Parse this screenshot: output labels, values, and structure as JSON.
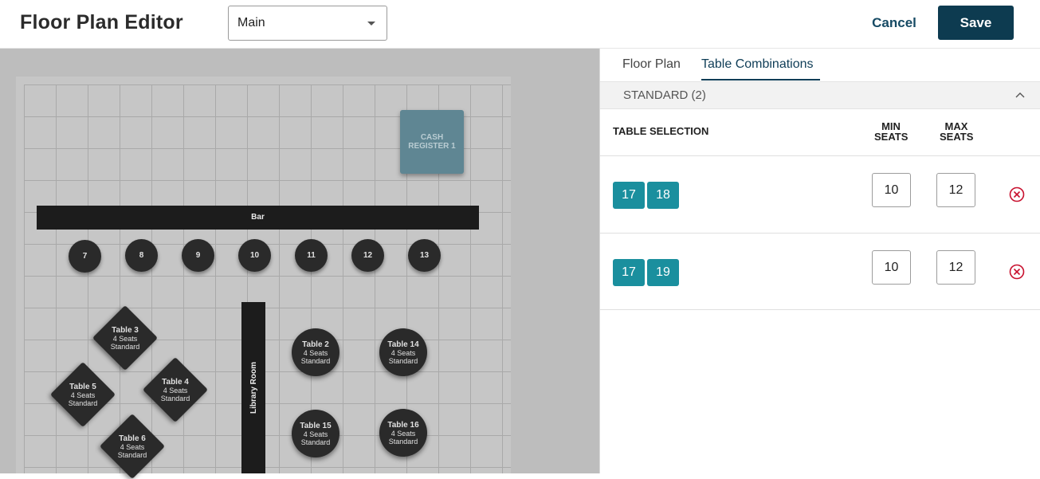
{
  "header": {
    "title": "Floor Plan Editor",
    "floor_select": {
      "value": "Main"
    },
    "cancel_label": "Cancel",
    "save_label": "Save"
  },
  "colors": {
    "primary": "#0d3b50",
    "chip": "#1a8f9e",
    "remove": "#c8102e"
  },
  "floor_plan": {
    "cash_register": "CASH REGISTER 1",
    "bar": "Bar",
    "library_room": "Library Room",
    "stools": [
      "7",
      "8",
      "9",
      "10",
      "11",
      "12",
      "13"
    ],
    "tables": [
      {
        "name": "Table 3",
        "seats": "4 Seats",
        "type": "Standard",
        "shape": "diamond"
      },
      {
        "name": "Table 4",
        "seats": "4 Seats",
        "type": "Standard",
        "shape": "diamond"
      },
      {
        "name": "Table 5",
        "seats": "4 Seats",
        "type": "Standard",
        "shape": "diamond"
      },
      {
        "name": "Table 6",
        "seats": "4 Seats",
        "type": "Standard",
        "shape": "diamond"
      },
      {
        "name": "Table 2",
        "seats": "4 Seats",
        "type": "Standard",
        "shape": "round"
      },
      {
        "name": "Table 14",
        "seats": "4 Seats",
        "type": "Standard",
        "shape": "round"
      },
      {
        "name": "Table 15",
        "seats": "4 Seats",
        "type": "Standard",
        "shape": "round"
      },
      {
        "name": "Table 16",
        "seats": "4 Seats",
        "type": "Standard",
        "shape": "round"
      }
    ]
  },
  "panel": {
    "tabs": [
      {
        "label": "Floor Plan",
        "active": false
      },
      {
        "label": "Table Combinations",
        "active": true
      }
    ],
    "section": {
      "label": "STANDARD (2)",
      "icon": "chevron-up-icon"
    },
    "columns": {
      "selection": "TABLE SELECTION",
      "min_line1": "MIN",
      "min_line2": "SEATS",
      "max_line1": "MAX",
      "max_line2": "SEATS"
    },
    "combinations": [
      {
        "tables": [
          "17",
          "18"
        ],
        "min_seats": "10",
        "max_seats": "12"
      },
      {
        "tables": [
          "17",
          "19"
        ],
        "min_seats": "10",
        "max_seats": "12"
      }
    ]
  }
}
